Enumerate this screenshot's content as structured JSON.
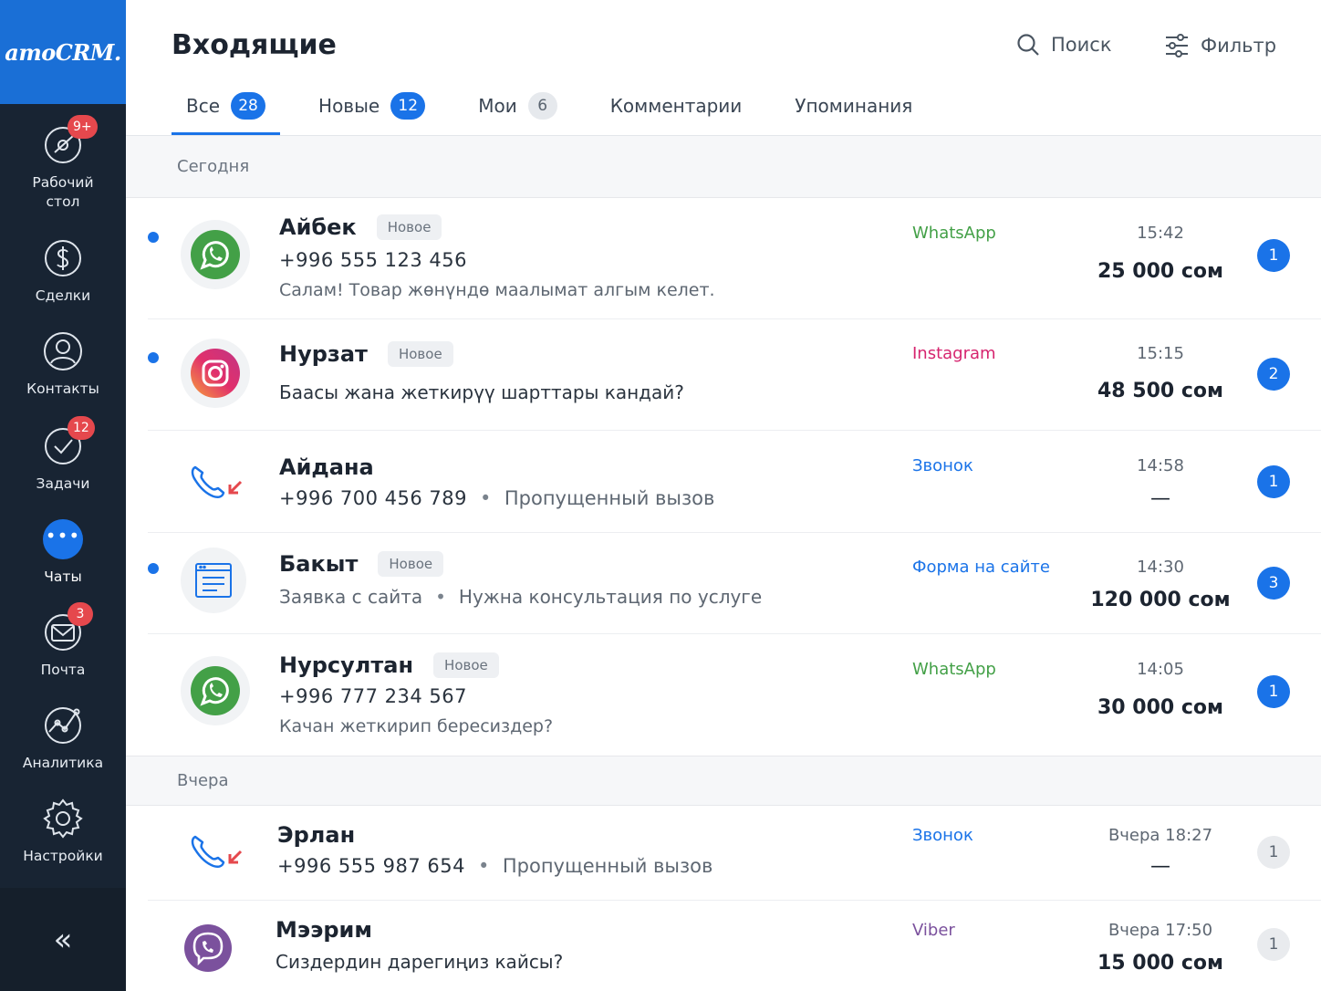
{
  "app": {
    "logo": "amoCRM."
  },
  "sidebar": {
    "items": [
      {
        "label": "Рабочий стол",
        "icon": "dashboard-icon",
        "badge": "9+"
      },
      {
        "label": "Сделки",
        "icon": "dollar-icon",
        "badge": ""
      },
      {
        "label": "Контакты",
        "icon": "contacts-icon",
        "badge": ""
      },
      {
        "label": "Задачи",
        "icon": "tasks-icon",
        "badge": "12"
      },
      {
        "label": "Чаты",
        "icon": "chat-icon",
        "badge": ""
      },
      {
        "label": "Почта",
        "icon": "mail-icon",
        "badge": "3"
      },
      {
        "label": "Аналитика",
        "icon": "analytics-icon",
        "badge": ""
      },
      {
        "label": "Настройки",
        "icon": "settings-icon",
        "badge": ""
      }
    ],
    "collapse": "«"
  },
  "header": {
    "title": "Входящие",
    "search_label": "Поиск",
    "filter_label": "Фильтр"
  },
  "tabs": [
    {
      "label": "Все",
      "count": "28"
    },
    {
      "label": "Новые",
      "count": "12"
    },
    {
      "label": "Мои",
      "count": "6"
    },
    {
      "label": "Комментарии",
      "count": ""
    },
    {
      "label": "Упоминания",
      "count": ""
    }
  ],
  "sections": {
    "today": "Сегодня",
    "yesterday": "Вчера"
  },
  "colors": {
    "accent": "#1a73e8",
    "whatsapp": "#43a047",
    "instagram": "#d6246e",
    "call": "#1a73e8",
    "viber": "#7b519d",
    "badge_red": "#e5484d"
  },
  "messages": [
    {
      "name": "Айбек",
      "badge": "Новое",
      "phone": "+996 555 123 456",
      "text": "Салам! Товар жөнүндө маалымат алгым келет.",
      "channel": "WhatsApp",
      "time": "15:42",
      "amount": "25 000 сом",
      "count": "1",
      "icon": "whatsapp-icon"
    },
    {
      "name": "Нурзат",
      "badge": "Новое",
      "text": "Баасы жана жеткирүү шарттары кандай?",
      "channel": "Instagram",
      "time": "15:15",
      "amount": "48 500 сом",
      "count": "2",
      "icon": "instagram-icon"
    },
    {
      "name": "Айдана",
      "phone": "+996 700 456 789",
      "text": "Пропущенный вызов",
      "channel": "Звонок",
      "time": "14:58",
      "amount": "—",
      "count": "1",
      "icon": "missed-call-icon"
    },
    {
      "name": "Бакыт",
      "badge": "Новое",
      "phone": "Заявка с сайта",
      "text": "Нужна консультация по услуге",
      "channel": "Форма на сайте",
      "time": "14:30",
      "amount": "120 000 сом",
      "count": "3",
      "icon": "web-form-icon"
    },
    {
      "name": "Нурсултан",
      "badge": "Новое",
      "phone": "+996 777 234 567",
      "text": "Качан жеткирип бересиздер?",
      "channel": "WhatsApp",
      "time": "14:05",
      "amount": "30 000 сом",
      "count": "1",
      "icon": "whatsapp-icon"
    },
    {
      "name": "Эрлан",
      "phone": "+996 555 987 654",
      "text": "Пропущенный вызов",
      "channel": "Звонок",
      "time": "Вчера 18:27",
      "amount": "—",
      "count": "1",
      "icon": "missed-call-icon"
    },
    {
      "name": "Мээрим",
      "text": "Сиздердин дарегиңиз кайсы?",
      "channel": "Viber",
      "time": "Вчера 17:50",
      "amount": "15 000 сом",
      "count": "1",
      "icon": "viber-icon"
    }
  ]
}
